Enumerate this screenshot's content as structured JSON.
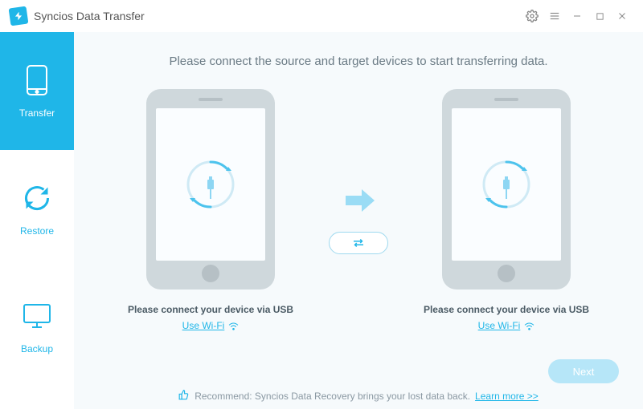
{
  "app": {
    "title": "Syncios Data Transfer"
  },
  "sidebar": {
    "items": [
      {
        "label": "Transfer",
        "active": true
      },
      {
        "label": "Restore",
        "active": false
      },
      {
        "label": "Backup",
        "active": false
      }
    ]
  },
  "main": {
    "headline": "Please connect the source and target devices to start transferring data.",
    "source": {
      "connect_msg": "Please connect your device via USB",
      "wifi_label": "Use Wi-Fi"
    },
    "target": {
      "connect_msg": "Please connect your device via USB",
      "wifi_label": "Use Wi-Fi"
    },
    "next_label": "Next"
  },
  "footer": {
    "recommend_prefix": "Recommend: Syncios Data Recovery brings your lost data back.",
    "learn_more": "Learn more >>"
  },
  "colors": {
    "accent": "#1fb6e8"
  }
}
